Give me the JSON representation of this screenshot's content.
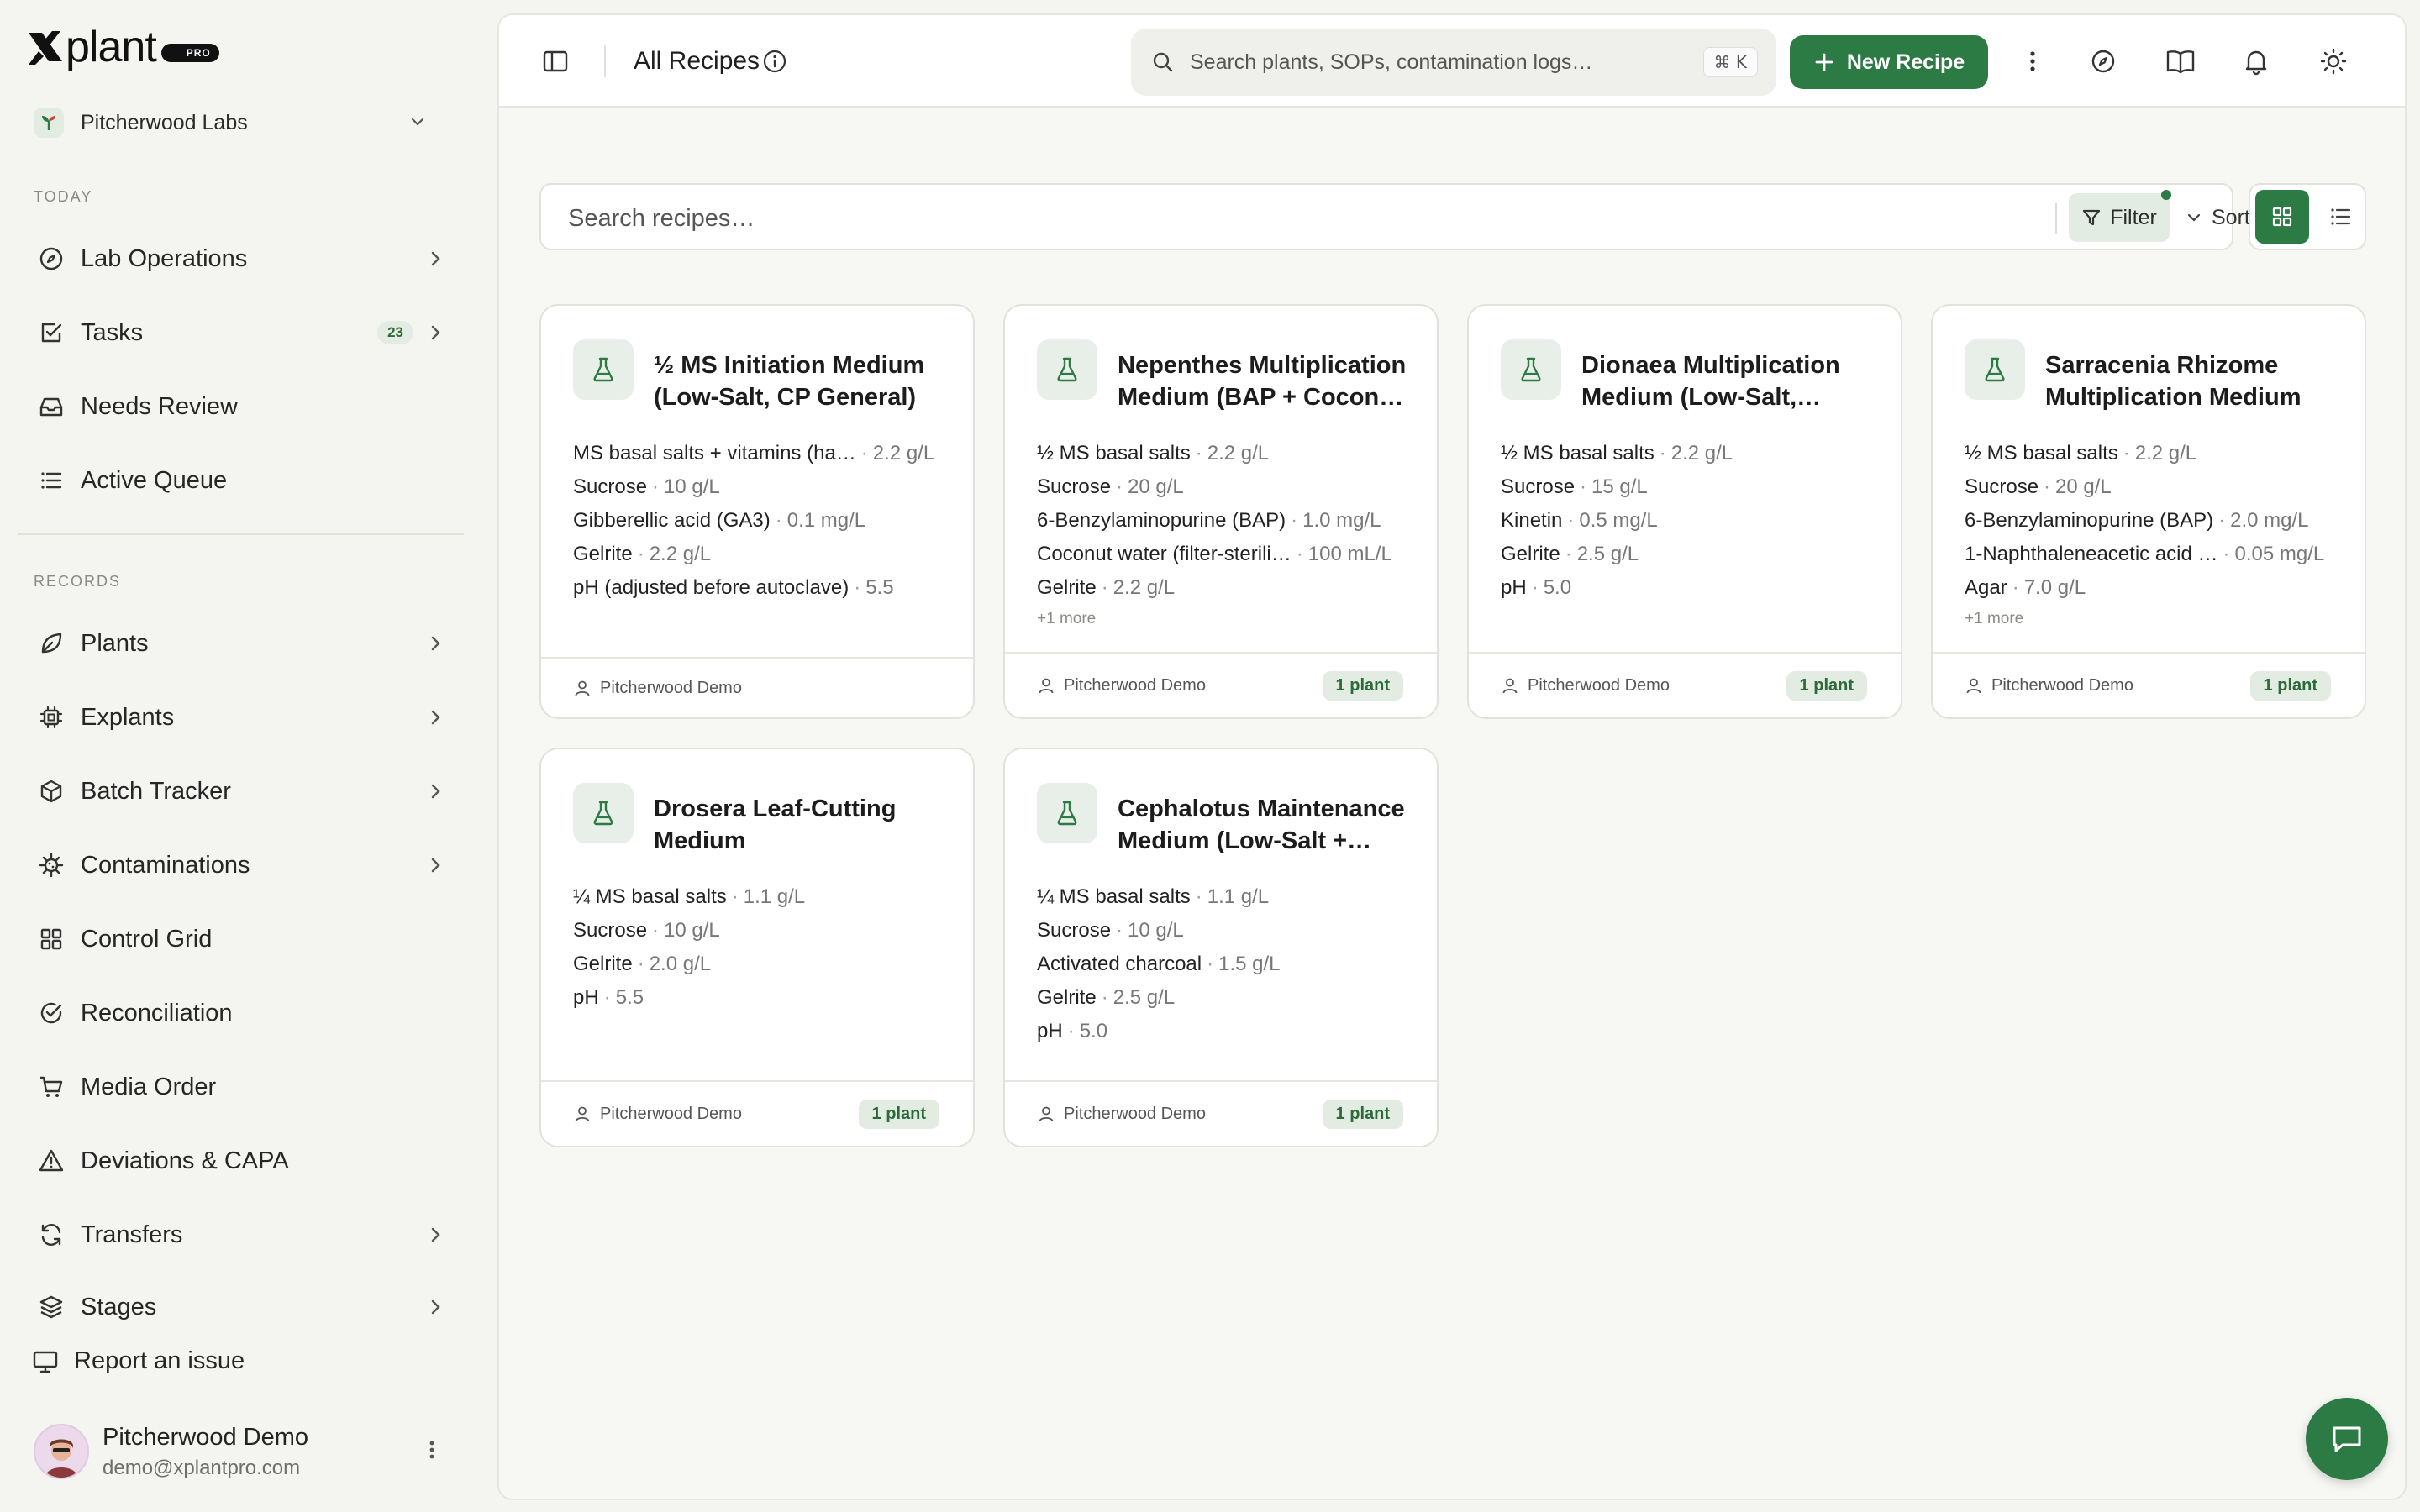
{
  "brand": {
    "logo_text": "plant",
    "badge": "PRO",
    "accent_color": "#2c7a44"
  },
  "sidebar": {
    "org_name": "Pitcherwood Labs",
    "today_label": "TODAY",
    "records_label": "RECORDS",
    "today_items": [
      {
        "label": "Lab Operations",
        "icon": "compass-icon",
        "chevron": true
      },
      {
        "label": "Tasks",
        "icon": "checkbox-icon",
        "chevron": true,
        "badge": "23"
      },
      {
        "label": "Needs Review",
        "icon": "inbox-icon",
        "chevron": false
      },
      {
        "label": "Active Queue",
        "icon": "list-icon",
        "chevron": false
      }
    ],
    "record_items": [
      {
        "label": "Plants",
        "icon": "leaf-icon",
        "chevron": true
      },
      {
        "label": "Explants",
        "icon": "chip-icon",
        "chevron": true
      },
      {
        "label": "Batch Tracker",
        "icon": "box-icon",
        "chevron": true
      },
      {
        "label": "Contaminations",
        "icon": "virus-icon",
        "chevron": true
      },
      {
        "label": "Control Grid",
        "icon": "grid-icon",
        "chevron": false
      },
      {
        "label": "Reconciliation",
        "icon": "check-circle-icon",
        "chevron": false
      },
      {
        "label": "Media Order",
        "icon": "cart-icon",
        "chevron": false
      },
      {
        "label": "Deviations & CAPA",
        "icon": "warning-icon",
        "chevron": false
      },
      {
        "label": "Transfers",
        "icon": "refresh-icon",
        "chevron": true
      },
      {
        "label": "Stages",
        "icon": "layers-icon",
        "chevron": true
      }
    ],
    "report_label": "Report an issue",
    "user": {
      "name": "Pitcherwood Demo",
      "email": "demo@xplantpro.com"
    }
  },
  "topbar": {
    "title": "All Recipes",
    "search_placeholder": "Search plants, SOPs, contamination logs…",
    "shortcut": "⌘ K",
    "new_button": "New Recipe"
  },
  "toolbar": {
    "search_placeholder": "Search recipes…",
    "filter_label": "Filter",
    "sort_label": "Sort"
  },
  "recipes": [
    {
      "title": "½ MS Initiation Medium (Low-Salt, CP General)",
      "ingredients": [
        {
          "name": "MS basal salts + vitamins (ha…",
          "value": "2.2 g/L"
        },
        {
          "name": "Sucrose",
          "value": "10 g/L"
        },
        {
          "name": "Gibberellic acid (GA3)",
          "value": "0.1 mg/L"
        },
        {
          "name": "Gelrite",
          "value": "2.2 g/L"
        },
        {
          "name": "pH (adjusted before autoclave)",
          "value": "5.5"
        }
      ],
      "more": "",
      "owner": "Pitcherwood Demo",
      "plants": ""
    },
    {
      "title": "Nepenthes Multiplication Medium (BAP + Cocon…",
      "ingredients": [
        {
          "name": "½ MS basal salts",
          "value": "2.2 g/L"
        },
        {
          "name": "Sucrose",
          "value": "20 g/L"
        },
        {
          "name": "6-Benzylaminopurine (BAP)",
          "value": "1.0 mg/L"
        },
        {
          "name": "Coconut water (filter-sterili…",
          "value": "100 mL/L"
        },
        {
          "name": "Gelrite",
          "value": "2.2 g/L"
        }
      ],
      "more": "+1 more",
      "owner": "Pitcherwood Demo",
      "plants": "1 plant"
    },
    {
      "title": "Dionaea Multiplication Medium (Low-Salt,…",
      "ingredients": [
        {
          "name": "½ MS basal salts",
          "value": "2.2 g/L"
        },
        {
          "name": "Sucrose",
          "value": "15 g/L"
        },
        {
          "name": "Kinetin",
          "value": "0.5 mg/L"
        },
        {
          "name": "Gelrite",
          "value": "2.5 g/L"
        },
        {
          "name": "pH",
          "value": "5.0"
        }
      ],
      "more": "",
      "owner": "Pitcherwood Demo",
      "plants": "1 plant"
    },
    {
      "title": "Sarracenia Rhizome Multiplication Medium",
      "ingredients": [
        {
          "name": "½ MS basal salts",
          "value": "2.2 g/L"
        },
        {
          "name": "Sucrose",
          "value": "20 g/L"
        },
        {
          "name": "6-Benzylaminopurine (BAP)",
          "value": "2.0 mg/L"
        },
        {
          "name": "1-Naphthaleneacetic acid …",
          "value": "0.05 mg/L"
        },
        {
          "name": "Agar",
          "value": "7.0 g/L"
        }
      ],
      "more": "+1 more",
      "owner": "Pitcherwood Demo",
      "plants": "1 plant"
    },
    {
      "title": "Drosera Leaf-Cutting Medium",
      "ingredients": [
        {
          "name": "¼ MS basal salts",
          "value": "1.1 g/L"
        },
        {
          "name": "Sucrose",
          "value": "10 g/L"
        },
        {
          "name": "Gelrite",
          "value": "2.0 g/L"
        },
        {
          "name": "pH",
          "value": "5.5"
        }
      ],
      "more": "",
      "owner": "Pitcherwood Demo",
      "plants": "1 plant"
    },
    {
      "title": "Cephalotus Maintenance Medium (Low-Salt +…",
      "ingredients": [
        {
          "name": "¼ MS basal salts",
          "value": "1.1 g/L"
        },
        {
          "name": "Sucrose",
          "value": "10 g/L"
        },
        {
          "name": "Activated charcoal",
          "value": "1.5 g/L"
        },
        {
          "name": "Gelrite",
          "value": "2.5 g/L"
        },
        {
          "name": "pH",
          "value": "5.0"
        }
      ],
      "more": "",
      "owner": "Pitcherwood Demo",
      "plants": "1 plant"
    }
  ]
}
